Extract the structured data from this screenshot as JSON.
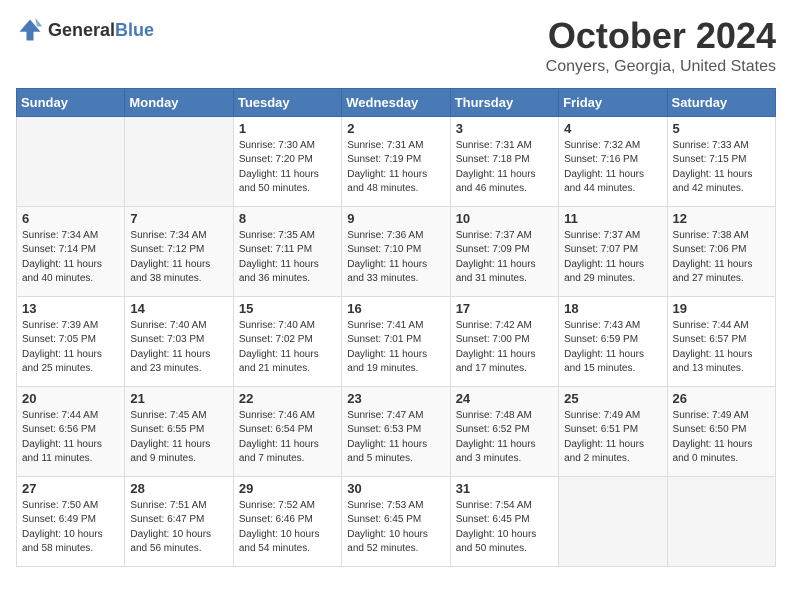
{
  "logo": {
    "general": "General",
    "blue": "Blue"
  },
  "header": {
    "month": "October 2024",
    "location": "Conyers, Georgia, United States"
  },
  "weekdays": [
    "Sunday",
    "Monday",
    "Tuesday",
    "Wednesday",
    "Thursday",
    "Friday",
    "Saturday"
  ],
  "weeks": [
    [
      {
        "day": "",
        "info": ""
      },
      {
        "day": "",
        "info": ""
      },
      {
        "day": "1",
        "info": "Sunrise: 7:30 AM\nSunset: 7:20 PM\nDaylight: 11 hours and 50 minutes."
      },
      {
        "day": "2",
        "info": "Sunrise: 7:31 AM\nSunset: 7:19 PM\nDaylight: 11 hours and 48 minutes."
      },
      {
        "day": "3",
        "info": "Sunrise: 7:31 AM\nSunset: 7:18 PM\nDaylight: 11 hours and 46 minutes."
      },
      {
        "day": "4",
        "info": "Sunrise: 7:32 AM\nSunset: 7:16 PM\nDaylight: 11 hours and 44 minutes."
      },
      {
        "day": "5",
        "info": "Sunrise: 7:33 AM\nSunset: 7:15 PM\nDaylight: 11 hours and 42 minutes."
      }
    ],
    [
      {
        "day": "6",
        "info": "Sunrise: 7:34 AM\nSunset: 7:14 PM\nDaylight: 11 hours and 40 minutes."
      },
      {
        "day": "7",
        "info": "Sunrise: 7:34 AM\nSunset: 7:12 PM\nDaylight: 11 hours and 38 minutes."
      },
      {
        "day": "8",
        "info": "Sunrise: 7:35 AM\nSunset: 7:11 PM\nDaylight: 11 hours and 36 minutes."
      },
      {
        "day": "9",
        "info": "Sunrise: 7:36 AM\nSunset: 7:10 PM\nDaylight: 11 hours and 33 minutes."
      },
      {
        "day": "10",
        "info": "Sunrise: 7:37 AM\nSunset: 7:09 PM\nDaylight: 11 hours and 31 minutes."
      },
      {
        "day": "11",
        "info": "Sunrise: 7:37 AM\nSunset: 7:07 PM\nDaylight: 11 hours and 29 minutes."
      },
      {
        "day": "12",
        "info": "Sunrise: 7:38 AM\nSunset: 7:06 PM\nDaylight: 11 hours and 27 minutes."
      }
    ],
    [
      {
        "day": "13",
        "info": "Sunrise: 7:39 AM\nSunset: 7:05 PM\nDaylight: 11 hours and 25 minutes."
      },
      {
        "day": "14",
        "info": "Sunrise: 7:40 AM\nSunset: 7:03 PM\nDaylight: 11 hours and 23 minutes."
      },
      {
        "day": "15",
        "info": "Sunrise: 7:40 AM\nSunset: 7:02 PM\nDaylight: 11 hours and 21 minutes."
      },
      {
        "day": "16",
        "info": "Sunrise: 7:41 AM\nSunset: 7:01 PM\nDaylight: 11 hours and 19 minutes."
      },
      {
        "day": "17",
        "info": "Sunrise: 7:42 AM\nSunset: 7:00 PM\nDaylight: 11 hours and 17 minutes."
      },
      {
        "day": "18",
        "info": "Sunrise: 7:43 AM\nSunset: 6:59 PM\nDaylight: 11 hours and 15 minutes."
      },
      {
        "day": "19",
        "info": "Sunrise: 7:44 AM\nSunset: 6:57 PM\nDaylight: 11 hours and 13 minutes."
      }
    ],
    [
      {
        "day": "20",
        "info": "Sunrise: 7:44 AM\nSunset: 6:56 PM\nDaylight: 11 hours and 11 minutes."
      },
      {
        "day": "21",
        "info": "Sunrise: 7:45 AM\nSunset: 6:55 PM\nDaylight: 11 hours and 9 minutes."
      },
      {
        "day": "22",
        "info": "Sunrise: 7:46 AM\nSunset: 6:54 PM\nDaylight: 11 hours and 7 minutes."
      },
      {
        "day": "23",
        "info": "Sunrise: 7:47 AM\nSunset: 6:53 PM\nDaylight: 11 hours and 5 minutes."
      },
      {
        "day": "24",
        "info": "Sunrise: 7:48 AM\nSunset: 6:52 PM\nDaylight: 11 hours and 3 minutes."
      },
      {
        "day": "25",
        "info": "Sunrise: 7:49 AM\nSunset: 6:51 PM\nDaylight: 11 hours and 2 minutes."
      },
      {
        "day": "26",
        "info": "Sunrise: 7:49 AM\nSunset: 6:50 PM\nDaylight: 11 hours and 0 minutes."
      }
    ],
    [
      {
        "day": "27",
        "info": "Sunrise: 7:50 AM\nSunset: 6:49 PM\nDaylight: 10 hours and 58 minutes."
      },
      {
        "day": "28",
        "info": "Sunrise: 7:51 AM\nSunset: 6:47 PM\nDaylight: 10 hours and 56 minutes."
      },
      {
        "day": "29",
        "info": "Sunrise: 7:52 AM\nSunset: 6:46 PM\nDaylight: 10 hours and 54 minutes."
      },
      {
        "day": "30",
        "info": "Sunrise: 7:53 AM\nSunset: 6:45 PM\nDaylight: 10 hours and 52 minutes."
      },
      {
        "day": "31",
        "info": "Sunrise: 7:54 AM\nSunset: 6:45 PM\nDaylight: 10 hours and 50 minutes."
      },
      {
        "day": "",
        "info": ""
      },
      {
        "day": "",
        "info": ""
      }
    ]
  ]
}
